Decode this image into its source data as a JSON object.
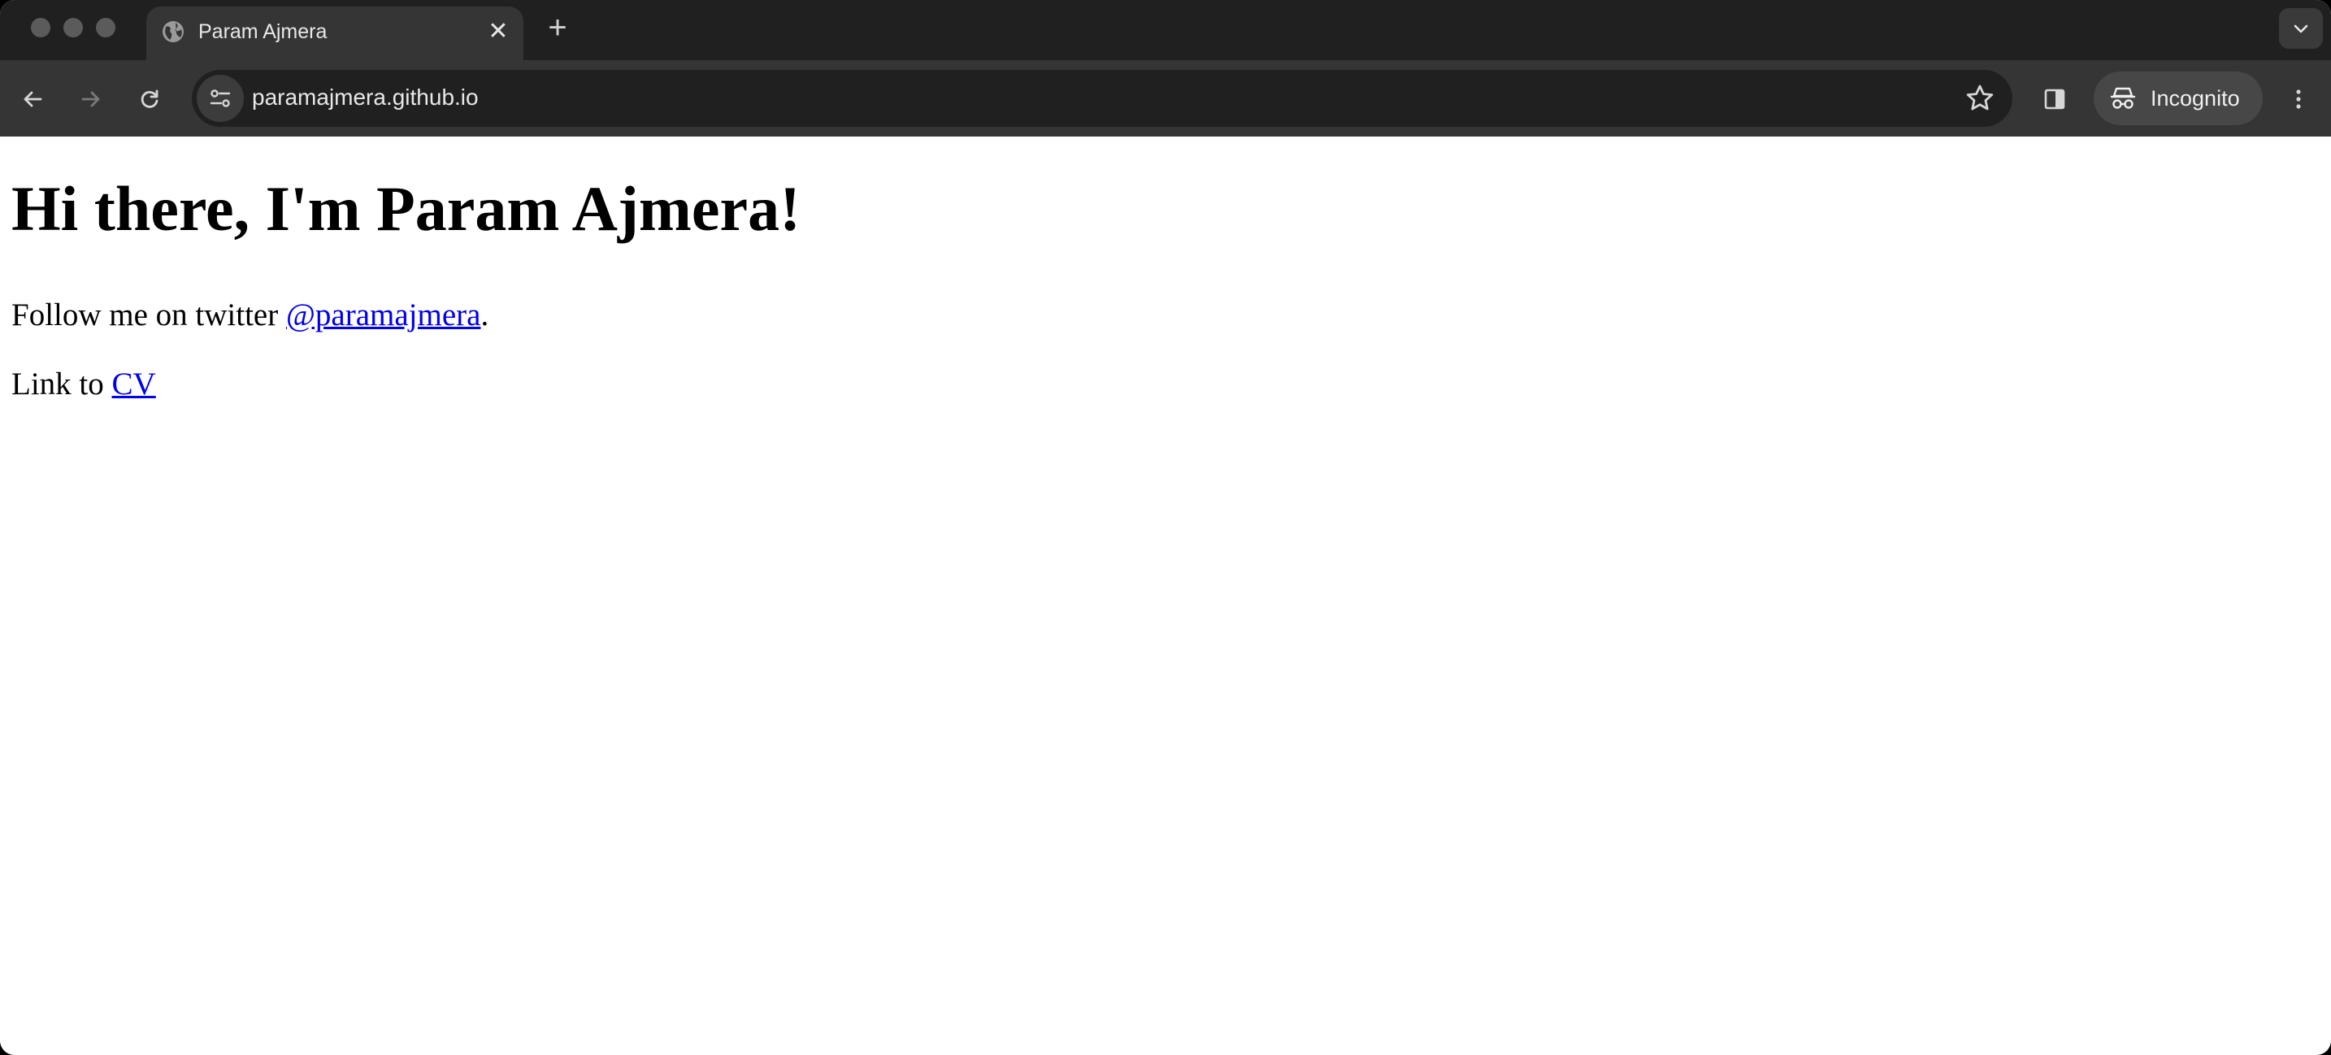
{
  "browser": {
    "tab": {
      "title": "Param Ajmera",
      "close_glyph": "✕"
    },
    "new_tab_glyph": "+",
    "address_bar": {
      "url": "paramajmera.github.io"
    },
    "incognito_label": "Incognito",
    "icons": [
      "globe-icon",
      "close-icon",
      "plus-icon",
      "chevron-down-icon",
      "back-arrow-icon",
      "forward-arrow-icon",
      "reload-icon",
      "site-settings-icon",
      "star-icon",
      "side-panel-icon",
      "incognito-icon",
      "kebab-menu-icon"
    ]
  },
  "page": {
    "heading": "Hi there, I'm Param Ajmera!",
    "twitter_line": {
      "prefix": "Follow me on twitter ",
      "link_text": "@paramajmera",
      "suffix": "."
    },
    "cv_line": {
      "prefix": "Link to ",
      "link_text": "CV"
    }
  },
  "colors": {
    "tabstrip_bg": "#202020",
    "toolbar_bg": "#353535",
    "link": "#0000ee"
  }
}
